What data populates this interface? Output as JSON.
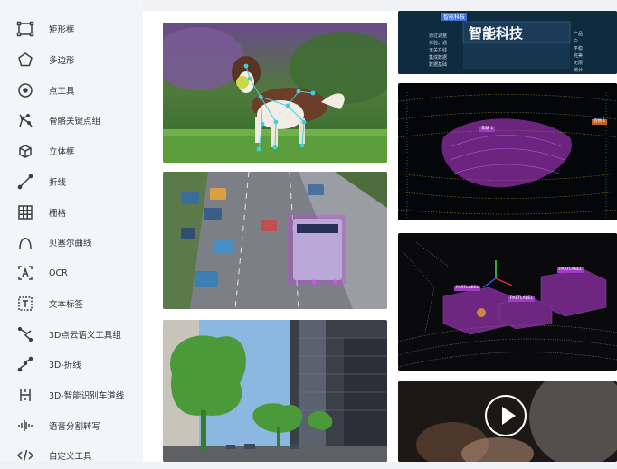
{
  "sidebar": {
    "tools": [
      {
        "icon": "rectangle-icon",
        "label": "矩形框"
      },
      {
        "icon": "polygon-icon",
        "label": "多边形"
      },
      {
        "icon": "point-icon",
        "label": "点工具"
      },
      {
        "icon": "skeleton-keypoints-icon",
        "label": "骨骼关键点组"
      },
      {
        "icon": "cuboid-icon",
        "label": "立体框"
      },
      {
        "icon": "polyline-icon",
        "label": "折线"
      },
      {
        "icon": "grid-icon",
        "label": "栅格"
      },
      {
        "icon": "bezier-curve-icon",
        "label": "贝塞尔曲线"
      },
      {
        "icon": "ocr-icon",
        "label": "OCR"
      },
      {
        "icon": "text-tag-icon",
        "label": "文本标签"
      },
      {
        "icon": "pointcloud-semantic-icon",
        "label": "3D点云语义工具组"
      },
      {
        "icon": "3d-polyline-icon",
        "label": "3D-折线"
      },
      {
        "icon": "lane-detection-icon",
        "label": "3D-智能识别车道线"
      },
      {
        "icon": "audio-waveform-icon",
        "label": "语音分割转写"
      },
      {
        "icon": "code-icon",
        "label": "自定义工具"
      }
    ]
  },
  "gallery": {
    "ocr_card": {
      "header_tag": "智能科技",
      "title": "智能科技",
      "left_lines": [
        "通过调整",
        "体验。通",
        "无关在线",
        "集成数据",
        "数据基础"
      ],
      "right_lines": [
        "产品",
        "户",
        "平稳",
        "完美",
        "无限",
        "统计"
      ]
    },
    "pointcloud_top": {
      "box_label": "车辆 1",
      "side_label": "货物 1"
    },
    "pointcloud_3d": {
      "labels": [
        "PARTLABEL",
        "PARTLABEL",
        "PARTLABEL"
      ]
    },
    "colors": {
      "accent_purple": "#c040e0",
      "keypoint_cyan": "#3fd0e0"
    }
  }
}
